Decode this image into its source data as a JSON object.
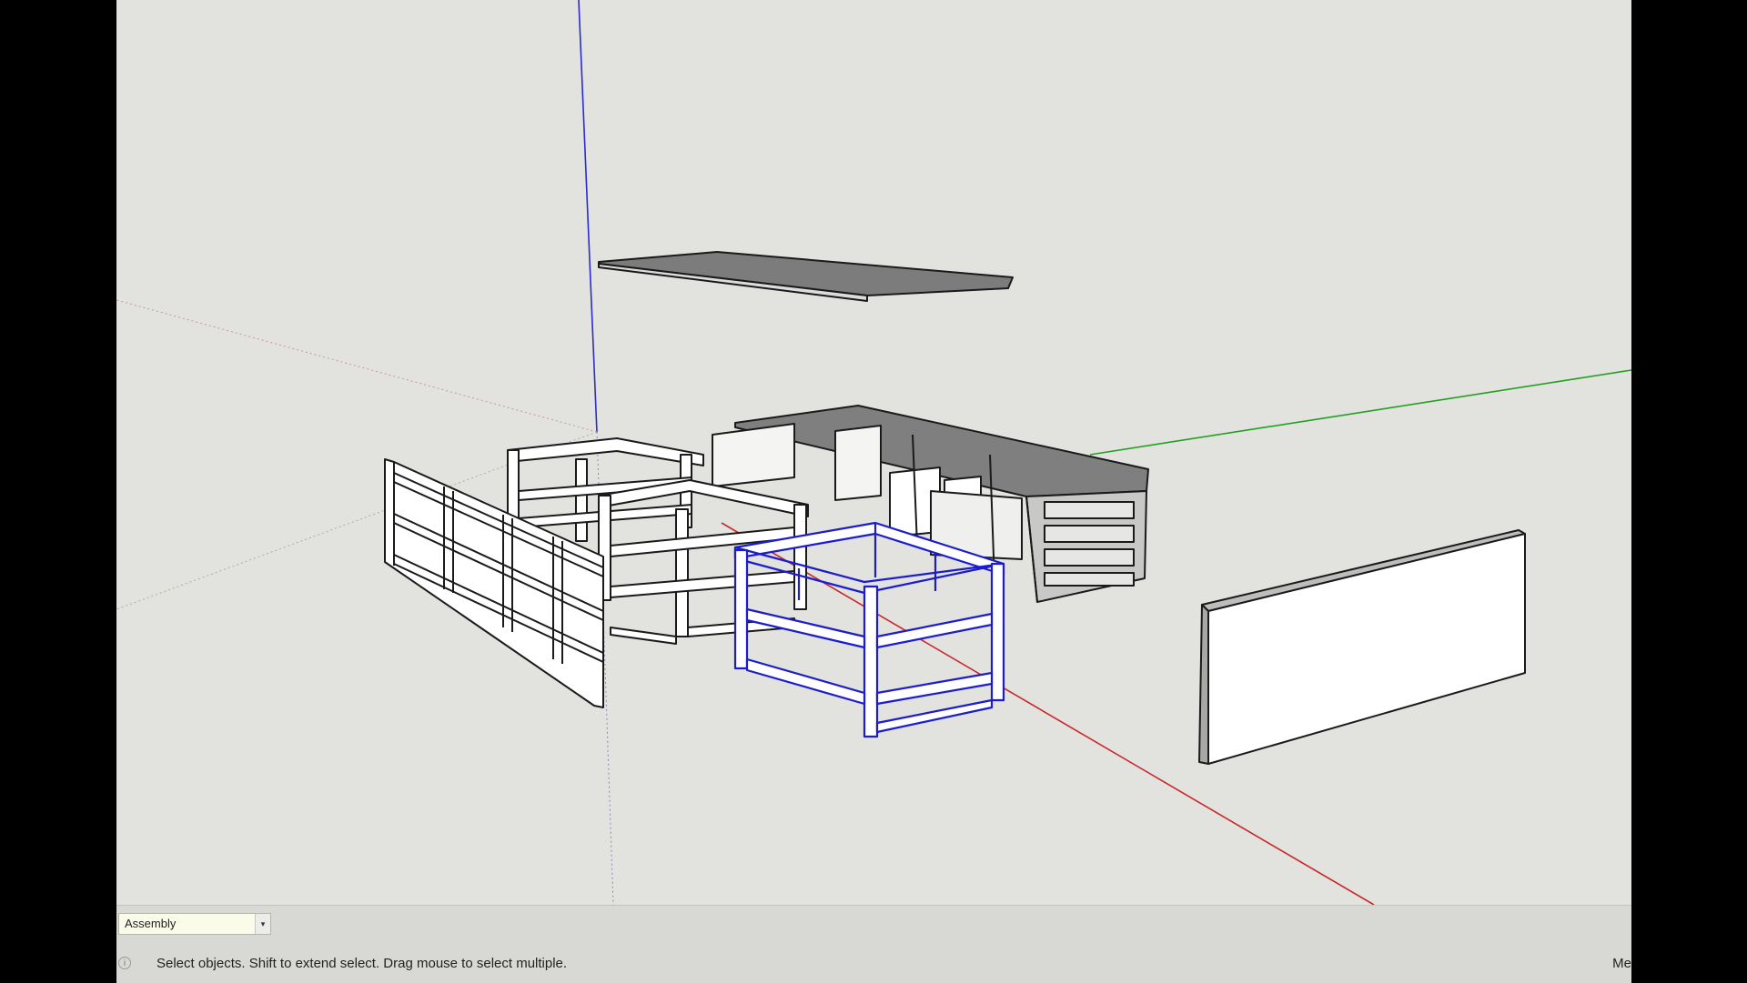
{
  "scene_tab": {
    "label": "Assembly",
    "arrow": "▾"
  },
  "status_bar": {
    "icon": "info-icon",
    "message": "Select objects. Shift to extend select. Drag mouse to select multiple.",
    "measurements_label": "Me"
  },
  "colors": {
    "background": "#e2e2df",
    "selection": "#1c1ccf",
    "axis_red": "#cc2222",
    "axis_green": "#22aa22",
    "axis_blue": "#2222cc",
    "edge": "#1a1a1a"
  }
}
